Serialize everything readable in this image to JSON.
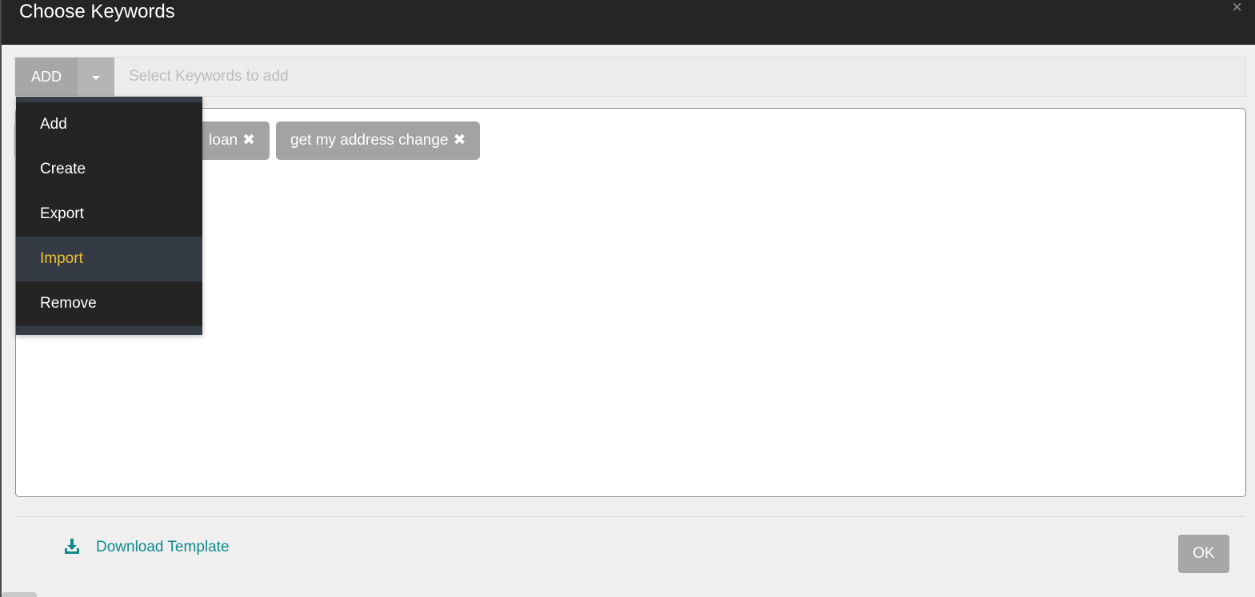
{
  "modal": {
    "title": "Choose Keywords",
    "close_icon": "close-icon"
  },
  "keyword_bar": {
    "add_label": "ADD",
    "input_placeholder": "Select Keywords to add",
    "input_value": ""
  },
  "chips": [
    {
      "label": "loan",
      "remove_glyph": "✖"
    },
    {
      "label": "get my address change",
      "remove_glyph": "✖"
    }
  ],
  "dropdown": {
    "items": [
      {
        "label": "Add",
        "active": false
      },
      {
        "label": "Create",
        "active": false
      },
      {
        "label": "Export",
        "active": false
      },
      {
        "label": "Import",
        "active": true
      },
      {
        "label": "Remove",
        "active": false
      }
    ]
  },
  "footer": {
    "download_label": "Download Template",
    "ok_label": "OK"
  },
  "colors": {
    "header_bg": "#252525",
    "menu_bg": "#242424",
    "menu_active_bg": "#353b45",
    "menu_active_text": "#f0c030",
    "link": "#118a8c",
    "button_gray": "#a7a7a7"
  }
}
